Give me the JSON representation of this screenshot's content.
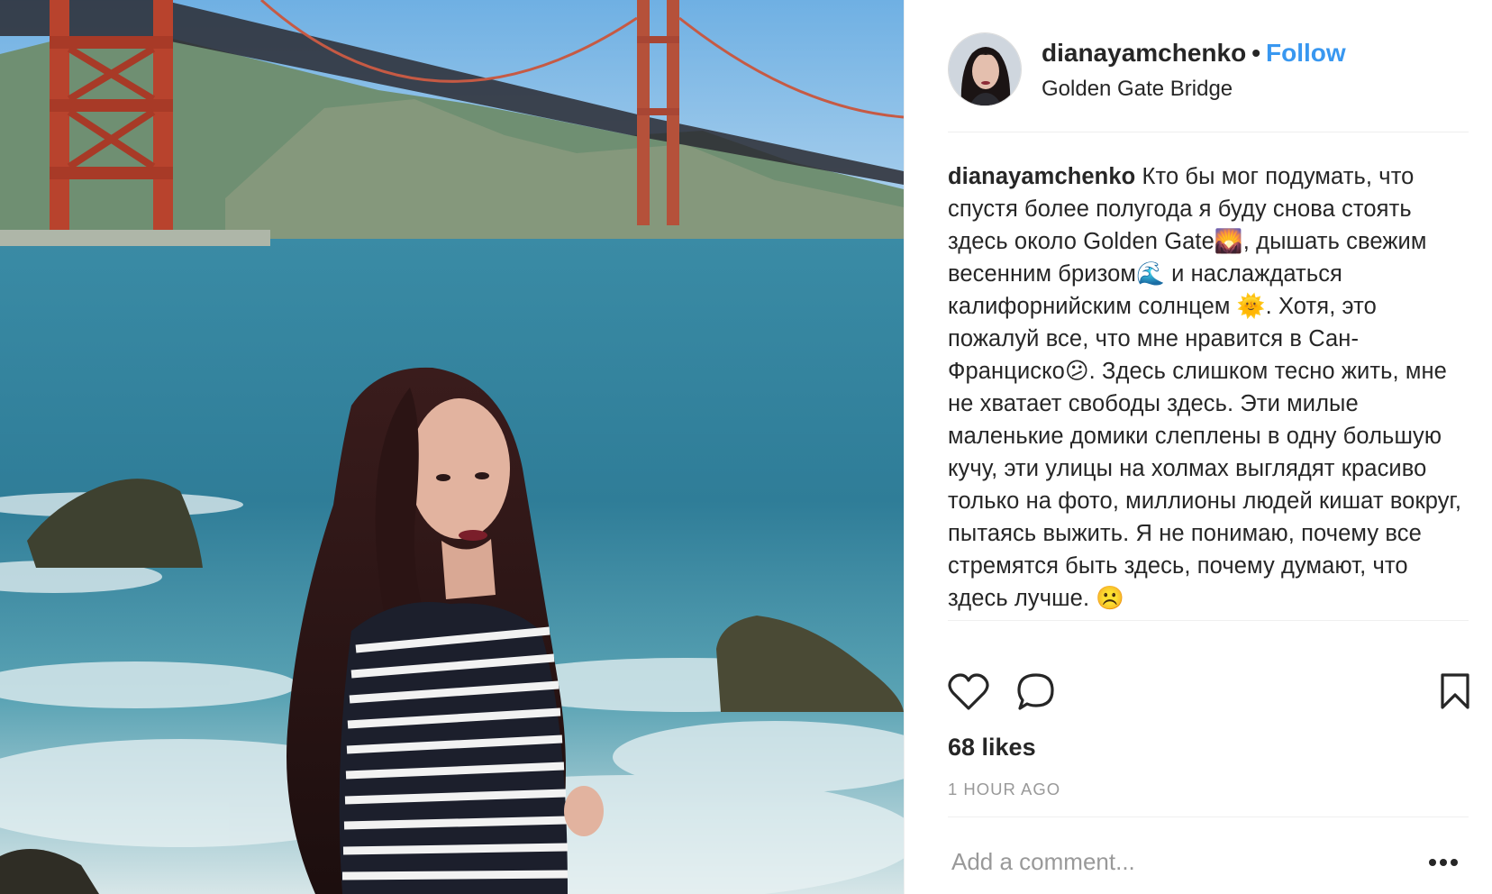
{
  "post": {
    "image_alt": "",
    "username": "dianayamchenko",
    "separator": "•",
    "follow_label": "Follow",
    "location": "Golden Gate Bridge",
    "caption_username": "dianayamchenko",
    "caption_text": "Кто бы мог подумать, что спустя более полугода я буду снова стоять здесь около Golden Gate🌄, дышать свежим весенним бризом🌊 и наслаждаться калифорнийским солнцем 🌞. Хотя, это пожалуй все, что мне нравится в Сан-Франциско😕. Здесь слишком тесно жить, мне не хватает свободы здесь. Эти милые маленькие домики слеплены в одну большую кучу, эти улицы на холмах выглядят красиво только на фото, миллионы людей кишат вокруг, пытаясь выжить. Я не понимаю, почему все стремятся быть здесь, почему думают, что здесь лучше. ☹️",
    "likes": "68 likes",
    "time_ago": "1 HOUR AGO",
    "comment_placeholder": "Add a comment..."
  },
  "icons": {
    "like": "heart-outline",
    "comment": "speech-bubble-outline",
    "save": "bookmark-outline",
    "more": "ellipsis-horizontal"
  },
  "colors": {
    "follow": "#3897f0",
    "text": "#262626",
    "muted": "#999999",
    "divider": "#efefef"
  }
}
